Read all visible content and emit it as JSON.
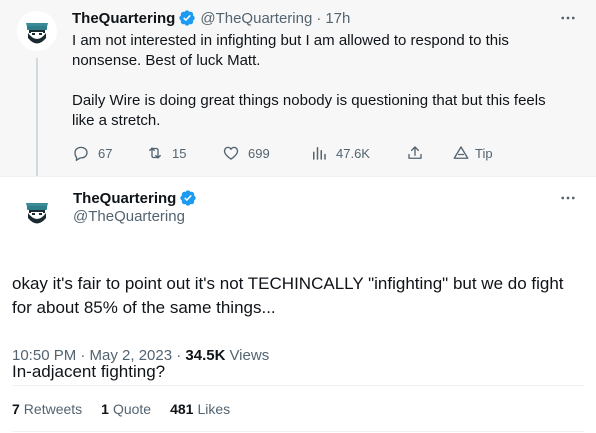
{
  "parent_tweet": {
    "name": "TheQuartering",
    "handle": "@TheQuartering",
    "separator": "·",
    "time": "17h",
    "text": "I am not interested in infighting but I am allowed to respond to this nonsense.   Best of luck Matt.\n\nDaily Wire is doing great things nobody is questioning that but this feels like a stretch.",
    "actions": {
      "replies": "67",
      "retweets": "15",
      "likes": "699",
      "views": "47.6K",
      "tip_label": "Tip"
    }
  },
  "main_tweet": {
    "name": "TheQuartering",
    "handle": "@TheQuartering",
    "paragraph1": "okay it's fair to point out it's not TECHINCALLY \"infighting\" but we do fight for about 85% of the same things...",
    "paragraph2": "In-adjacent fighting?",
    "timestamp": "10:50 PM · May 2, 2023 · ",
    "views_count": "34.5K",
    "views_label": "Views"
  },
  "stats": {
    "retweets_count": "7",
    "retweets_label": "Retweets",
    "quotes_count": "1",
    "quotes_label": "Quote",
    "likes_count": "481",
    "likes_label": "Likes"
  },
  "icons": {
    "verified": "verified-badge-icon",
    "more": "more-options-icon",
    "reply": "reply-bubble-icon",
    "retweet": "retweet-icon",
    "like": "heart-icon",
    "views": "bar-chart-icon",
    "share": "share-upload-icon",
    "tip": "tip-icon"
  },
  "colors": {
    "verified_blue": "#1d9bf0",
    "secondary_text": "#536471",
    "primary_text": "#0f1419",
    "parent_background": "#f7f7f7",
    "avatar_teal": "#2f7d8a"
  }
}
